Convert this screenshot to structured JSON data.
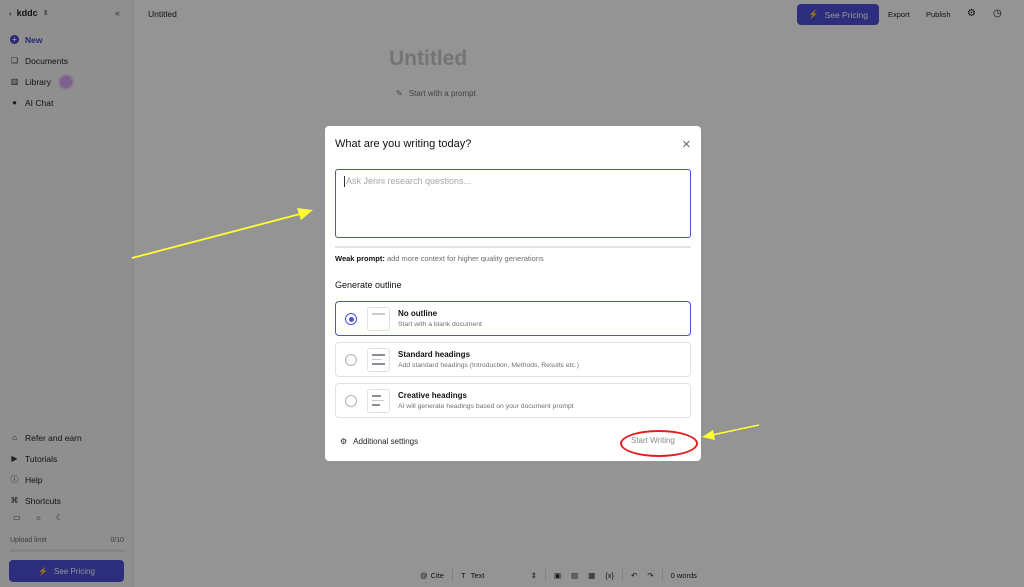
{
  "sidebar": {
    "workspace": "kddc",
    "items": [
      {
        "label": "New"
      },
      {
        "label": "Documents"
      },
      {
        "label": "Library"
      },
      {
        "label": "AI Chat"
      }
    ],
    "bottom_items": [
      {
        "label": "Refer and earn"
      },
      {
        "label": "Tutorials"
      },
      {
        "label": "Help"
      },
      {
        "label": "Shortcuts"
      }
    ],
    "upload": {
      "label": "Upload limit",
      "count": "0/10"
    },
    "pricing_label": "See Pricing"
  },
  "topbar": {
    "doc_tab": "Untitled",
    "pricing_label": "See Pricing",
    "export": "Export",
    "publish": "Publish"
  },
  "doc": {
    "title": "Untitled",
    "start_prompt": "Start with a prompt"
  },
  "toolbar": {
    "cite": "Cite",
    "text_style": "Text",
    "words": "0 words"
  },
  "modal": {
    "title": "What are you writing today?",
    "placeholder": "Ask Jenni research questions...",
    "weak_label": "Weak prompt:",
    "weak_text": " add more context for higher quality generations",
    "outline_heading": "Generate outline",
    "options": [
      {
        "title": "No outline",
        "subtitle": "Start with a blank document",
        "selected": true
      },
      {
        "title": "Standard headings",
        "subtitle": "Add standard headings (Introduction, Methods, Results etc.)",
        "selected": false
      },
      {
        "title": "Creative headings",
        "subtitle": "AI will generate headings based on your document prompt",
        "selected": false
      }
    ],
    "additional_settings": "Additional settings",
    "start_writing": "Start Writing"
  },
  "colors": {
    "accent": "#4f4fd1",
    "annotation_arrow": "#ffff33",
    "annotation_circle": "#e02020"
  }
}
